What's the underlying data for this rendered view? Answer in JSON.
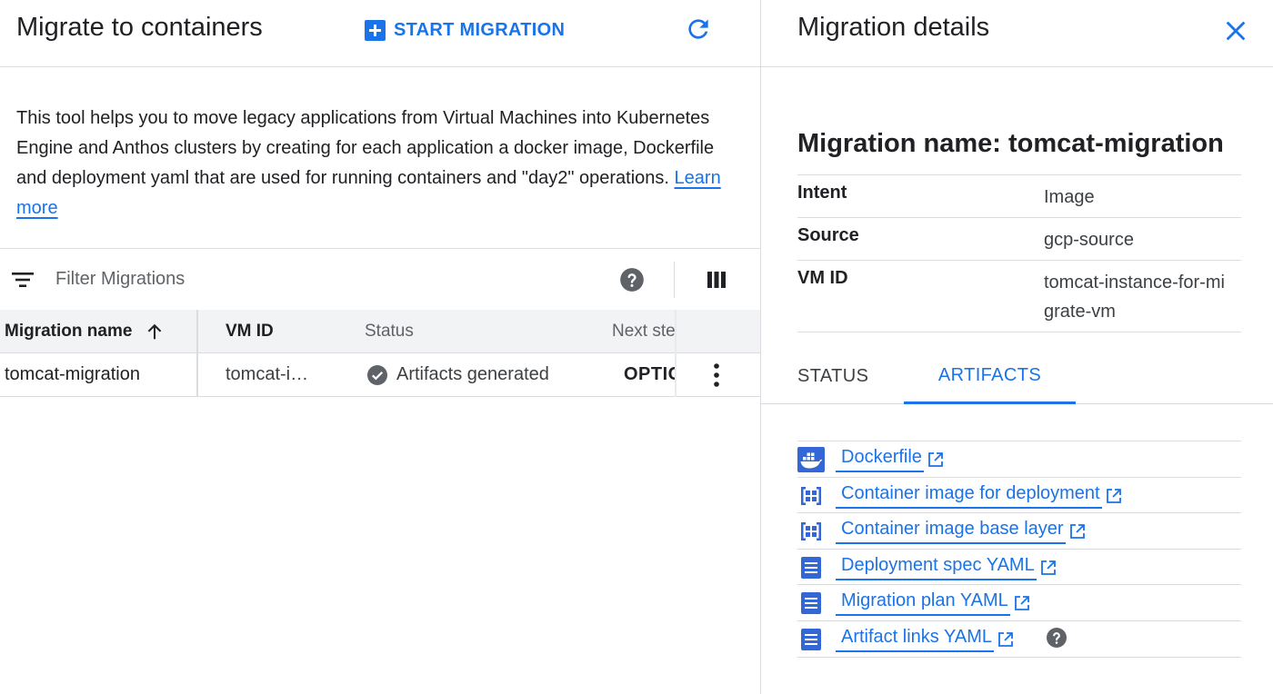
{
  "header": {
    "title": "Migrate to containers",
    "start_label": "START MIGRATION"
  },
  "description": {
    "text": "This tool helps you to move legacy applications from Virtual Machines into Kubernetes Engine and Anthos clusters by creating for each application a docker image, Dockerfile and deployment yaml that are used for running containers and \"day2\" operations.",
    "learn_more": "Learn more"
  },
  "filter": {
    "placeholder": "Filter Migrations"
  },
  "table": {
    "columns": [
      "Migration name",
      "VM ID",
      "Status",
      "Next ste"
    ],
    "rows": [
      {
        "name": "tomcat-migration",
        "vm_id": "tomcat-i…",
        "status": "Artifacts generated",
        "next": "OPTIC"
      }
    ]
  },
  "details": {
    "title": "Migration details",
    "migration_name": "Migration name: tomcat-migration",
    "fields": [
      {
        "key": "Intent",
        "value": "Image"
      },
      {
        "key": "Source",
        "value": "gcp-source"
      },
      {
        "key": "VM ID",
        "value": "tomcat-instance-for-migrate-vm"
      }
    ],
    "tabs": [
      "STATUS",
      "ARTIFACTS"
    ],
    "artifacts": [
      {
        "label": "Dockerfile",
        "icon": "docker-icon"
      },
      {
        "label": "Container image for deployment",
        "icon": "container-image-icon"
      },
      {
        "label": "Container image base layer",
        "icon": "container-image-icon"
      },
      {
        "label": "Deployment spec YAML",
        "icon": "document-icon"
      },
      {
        "label": "Migration plan YAML",
        "icon": "document-icon"
      },
      {
        "label": "Artifact links YAML",
        "icon": "document-icon"
      }
    ]
  },
  "colors": {
    "accent": "#1a73e8",
    "text": "#202124",
    "divider": "#dadce0",
    "icon": "#5f6368"
  }
}
